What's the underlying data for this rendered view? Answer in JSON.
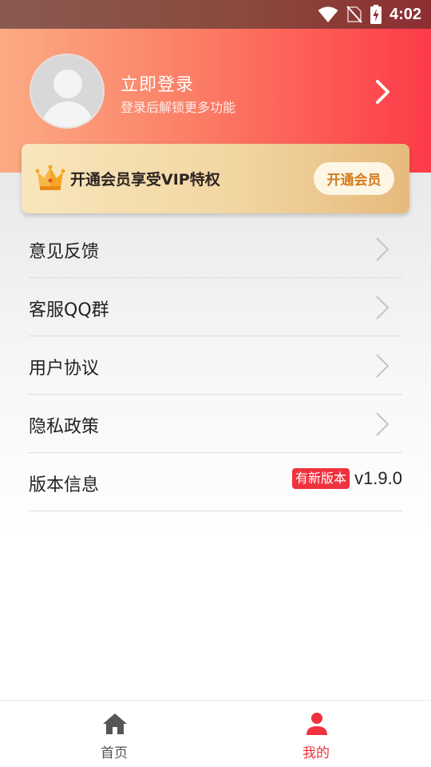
{
  "status_bar": {
    "time": "4:02",
    "icons": [
      "wifi-icon",
      "no-sim-icon",
      "battery-charging-icon"
    ]
  },
  "header": {
    "login_title": "立即登录",
    "login_subtitle": "登录后解锁更多功能",
    "arrow_icon": "chevron-right-icon"
  },
  "vip": {
    "icon": "crown-icon",
    "text": "开通会员享受VIP特权",
    "button_label": "开通会员"
  },
  "menu": {
    "items": [
      {
        "label": "意见反馈"
      },
      {
        "label": "客服QQ群"
      },
      {
        "label": "用户协议"
      },
      {
        "label": "隐私政策"
      }
    ],
    "version": {
      "label": "版本信息",
      "badge": "有新版本",
      "value": "v1.9.0"
    }
  },
  "tab_bar": {
    "tabs": [
      {
        "label": "首页",
        "icon": "home-icon",
        "active": false
      },
      {
        "label": "我的",
        "icon": "user-icon",
        "active": true
      }
    ]
  },
  "colors": {
    "accent": "#f0313e",
    "header_start": "#fbab84",
    "header_end": "#fc3b48",
    "vip_gold": "#f2d6a2",
    "vip_button_text": "#d47a1b"
  }
}
